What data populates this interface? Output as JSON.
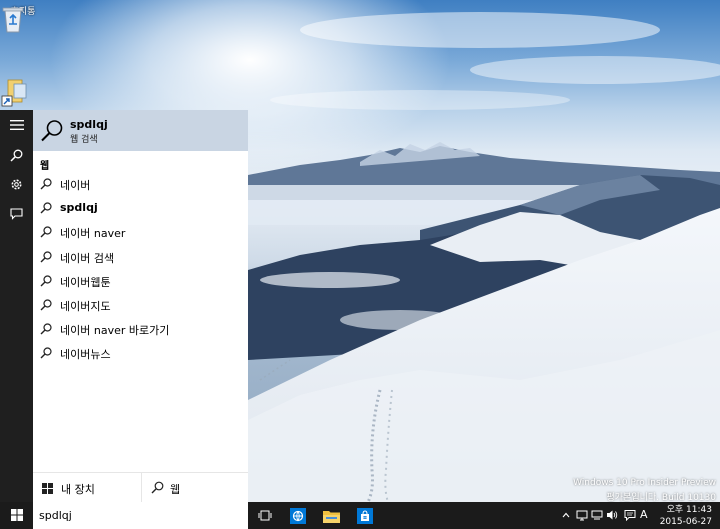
{
  "desktop": {
    "icons": [
      {
        "name": "recycle-bin",
        "label": "휴지통"
      },
      {
        "name": "shortcut",
        "label": ""
      }
    ],
    "watermark": {
      "line1": "Windows 10 Pro Insider Preview",
      "line2": "평가본입니다. Build 10130"
    }
  },
  "search_panel": {
    "best_match": {
      "title": "spdlqj",
      "subtitle": "웹 검색"
    },
    "section_label": "웹",
    "suggestions": [
      {
        "text": "네이버",
        "bold": false
      },
      {
        "text": "spdlqj",
        "bold": true
      },
      {
        "text": "네이버 naver",
        "bold": false
      },
      {
        "text": "네이버 검색",
        "bold": false
      },
      {
        "text": "네이버웹툰",
        "bold": false
      },
      {
        "text": "네이버지도",
        "bold": false
      },
      {
        "text": "네이버 naver 바로가기",
        "bold": false
      },
      {
        "text": "네이버뉴스",
        "bold": false
      }
    ],
    "filters": {
      "my_stuff": "내 장치",
      "web": "웹"
    }
  },
  "taskbar": {
    "search_value": "spdlqj",
    "clock": {
      "time": "오후 11:43",
      "date": "2015-06-27"
    },
    "ime_label": "A"
  },
  "colors": {
    "accent": "#0078d7",
    "selection": "#c9d5e3",
    "rail": "#1f1f1f",
    "taskbar": "#1b1b1b"
  }
}
